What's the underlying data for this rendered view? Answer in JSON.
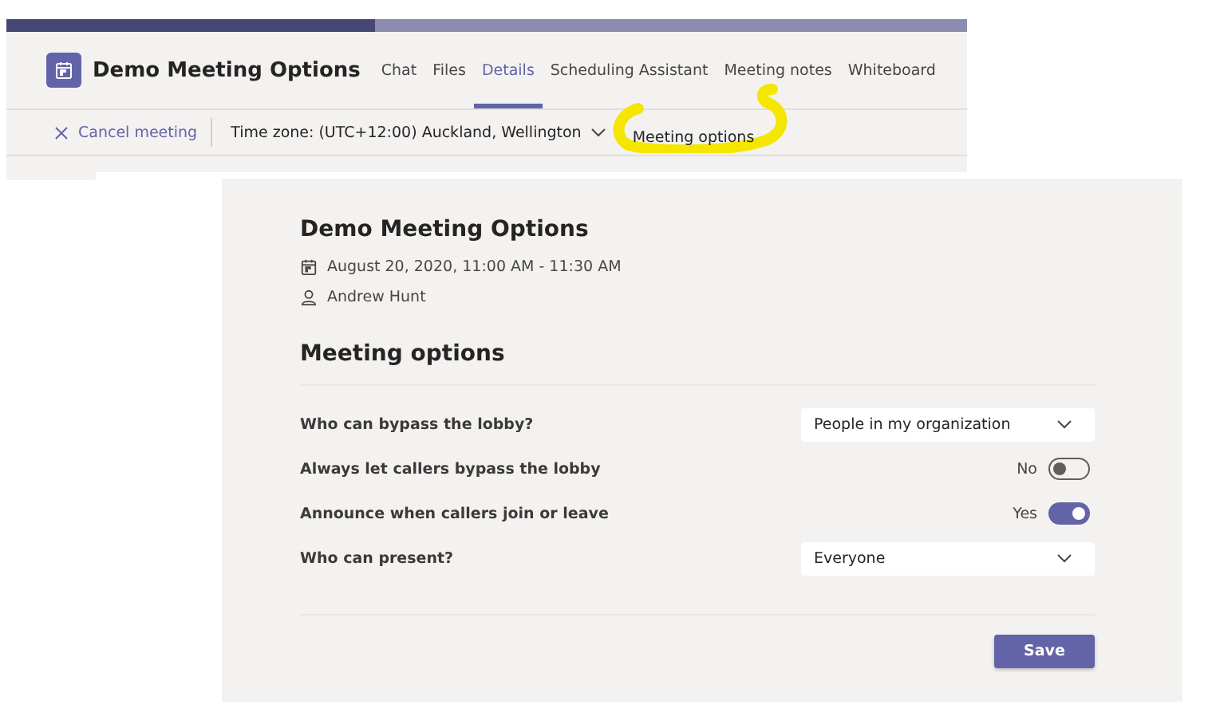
{
  "header": {
    "title": "Demo Meeting Options",
    "tabs": [
      {
        "label": "Chat",
        "selected": false
      },
      {
        "label": "Files",
        "selected": false
      },
      {
        "label": "Details",
        "selected": true
      },
      {
        "label": "Scheduling Assistant",
        "selected": false
      },
      {
        "label": "Meeting notes",
        "selected": false
      },
      {
        "label": "Whiteboard",
        "selected": false
      }
    ]
  },
  "toolbar": {
    "cancel": "Cancel meeting",
    "time_zone": "Time zone: (UTC+12:00) Auckland, Wellington",
    "meeting_options": "Meeting options"
  },
  "options_page": {
    "title": "Demo Meeting Options",
    "date": "August 20, 2020, 11:00 AM - 11:30 AM",
    "organizer": "Andrew Hunt",
    "section_title": "Meeting options",
    "settings": [
      {
        "kind": "dropdown",
        "label": "Who can bypass the lobby?",
        "value": "People in my organization"
      },
      {
        "kind": "toggle",
        "label": "Always let callers bypass the lobby",
        "state_text": "No",
        "on": false
      },
      {
        "kind": "toggle",
        "label": "Announce when callers join or leave",
        "state_text": "Yes",
        "on": true
      },
      {
        "kind": "dropdown",
        "label": "Who can present?",
        "value": "Everyone"
      }
    ],
    "save": "Save"
  }
}
